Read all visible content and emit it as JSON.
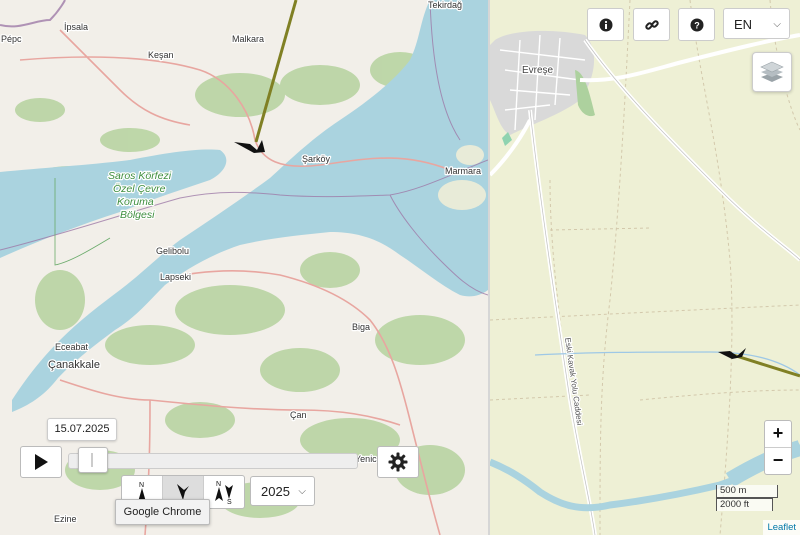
{
  "left_map": {
    "places": {
      "tekirdag": "Tekirdağ",
      "ipsala": "İpsala",
      "kesan": "Keşan",
      "malkara": "Malkara",
      "sarkoy": "Şarköy",
      "marmara": "Marmara",
      "gelibolu": "Gelibolu",
      "lapseki": "Lapseki",
      "eceabat": "Eceabat",
      "canakkale": "Çanakkale",
      "biga": "Biga",
      "can": "Çan",
      "ezine": "Ezine",
      "yenice": "Yenice",
      "pec": "Pépc"
    },
    "reserve_label": [
      "Saros Körfezi",
      "Özel Çevre",
      "Koruma",
      "Bölgesi"
    ]
  },
  "player": {
    "date": "15.07.2025",
    "progress": 0.03,
    "year": "2025",
    "orientation_options": [
      "N",
      "track",
      "N/S"
    ],
    "active_orientation": "track",
    "tooltip": "Google Chrome"
  },
  "right_map": {
    "place": "Evreşe",
    "road_label": "Eski Kavak Yolu Caddesi",
    "language": "EN",
    "zoom_in": "+",
    "zoom_out": "−",
    "scale_metric": "500 m",
    "scale_imperial": "2000 ft",
    "attribution": "Leaflet"
  },
  "colors": {
    "sea": "#aad3df",
    "land": "#f2efe9",
    "forest": "#add19e",
    "farmland": "#eef0d5",
    "track": "#8a8a2a",
    "road_major": "#e8a6a0",
    "road_minor": "#f7fabf"
  }
}
